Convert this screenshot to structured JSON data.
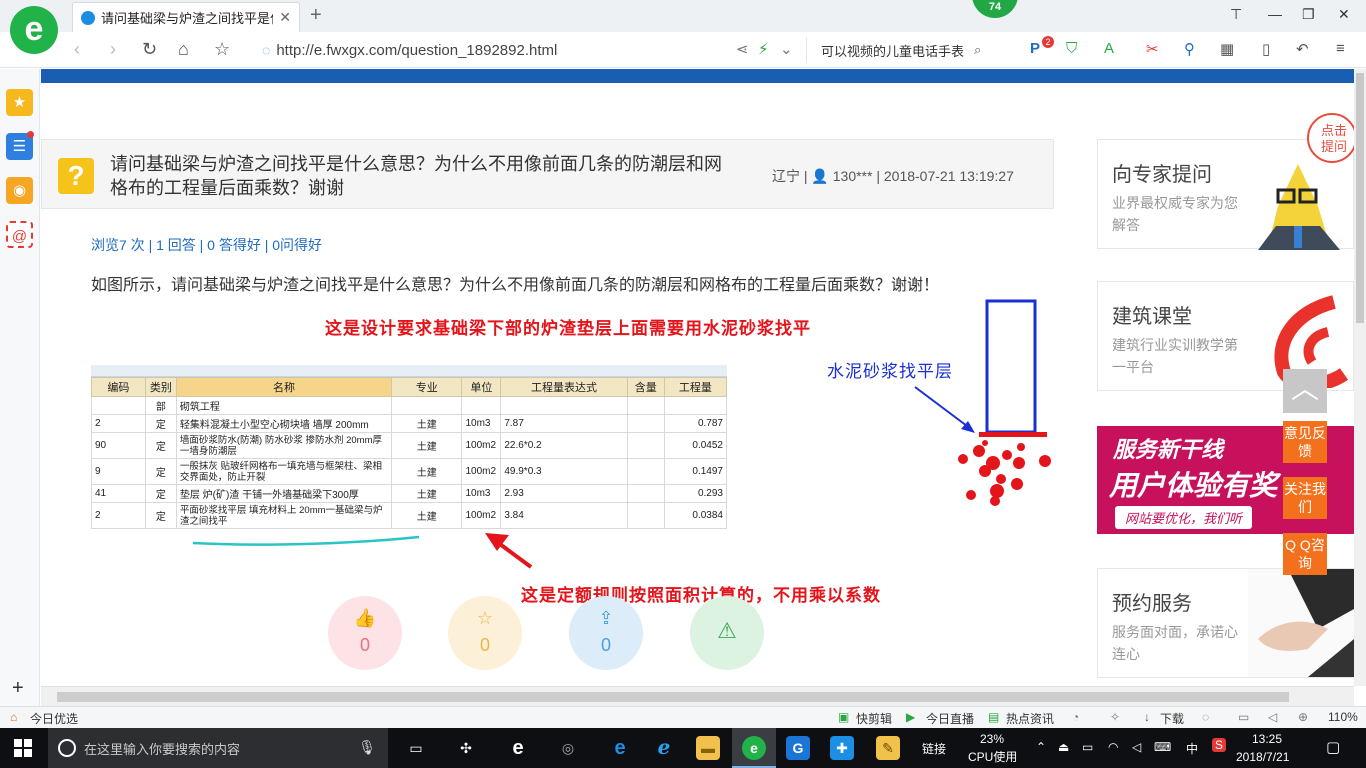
{
  "browser": {
    "tab_title": "请问基础梁与炉渣之间找平是什么",
    "new_tab_icon": "plus-icon",
    "badge_count": "74",
    "url": "http://e.fwxgx.com/question_1892892.html",
    "search_text": "可以视频的儿童电话手表",
    "toolbar_badge": "2"
  },
  "question": {
    "title": "请问基础梁与炉渣之间找平是什么意思？为什么不用像前面几条的防潮层和网格布的工程量后面乘数？谢谢",
    "location": "辽宁",
    "user": "130***",
    "time": "2018-07-21 13:19:27",
    "stats": "浏览7 次 | 1 回答 | 0 答得好 | 0问得好",
    "body": "如图所示，请问基础梁与炉渣之间找平是什么意思？为什么不用像前面几条的防潮层和网格布的工程量后面乘数？谢谢！",
    "annotation_top": "这是设计要求基础梁下部的炉渣垫层上面需要用水泥砂浆找平",
    "annotation_layer": "水泥砂浆找平层",
    "annotation_bottom": "这是定额规则按照面积计算的，不用乘以系数"
  },
  "table": {
    "headers": [
      "编码",
      "类别",
      "名称",
      "专业",
      "单位",
      "工程量表达式",
      "含量",
      "工程量"
    ],
    "rows": [
      [
        "",
        "部",
        "砌筑工程",
        "",
        "",
        "",
        "",
        ""
      ],
      [
        "2",
        "定",
        "轻集料混凝土小型空心砌块墙 墙厚 200mm",
        "土建",
        "10m3",
        "7.87",
        "",
        "0.787"
      ],
      [
        "90",
        "定",
        "墙面砂浆防水(防潮) 防水砂浆 掺防水剂 20mm厚一墙身防潮层",
        "土建",
        "100m2",
        "22.6*0.2",
        "",
        "0.0452"
      ],
      [
        "9",
        "定",
        "一般抹灰 贴玻纤网格布一填充墙与框架柱、梁相交界面处，防止开裂",
        "土建",
        "100m2",
        "49.9*0.3",
        "",
        "0.1497"
      ],
      [
        "41",
        "定",
        "垫层 炉(矿)渣 干铺一外墙基础梁下300厚",
        "土建",
        "10m3",
        "2.93",
        "",
        "0.293"
      ],
      [
        "2",
        "定",
        "平面砂浆找平层 填充材料上 20mm一基础梁与炉渣之间找平",
        "土建",
        "100m2",
        "3.84",
        "",
        "0.0384"
      ]
    ]
  },
  "reactions": [
    {
      "icon": "thumbs-up-icon",
      "count": "0"
    },
    {
      "icon": "star-icon",
      "count": "0"
    },
    {
      "icon": "share-icon",
      "count": "0"
    },
    {
      "icon": "warning-icon",
      "count": ""
    }
  ],
  "sidebar": {
    "expert": {
      "title": "向专家提问",
      "subtitle": "业界最权威专家为您解答",
      "bubble": "点击提问"
    },
    "academy": {
      "title": "建筑课堂",
      "subtitle": "建筑行业实训教学第一平台"
    },
    "banner": {
      "line1": "服务新干线",
      "line2": "用户体验有奖",
      "line3": "网站要优化，我们听"
    },
    "booking": {
      "title": "预约服务",
      "subtitle": "服务面对面，承诺心连心"
    }
  },
  "floating": {
    "feedback": "意见反馈",
    "follow": "关注我们",
    "qq": "Q Q咨询"
  },
  "statusbar": {
    "left": "今日优选",
    "kuaijianji": "快剪辑",
    "live": "今日直播",
    "news": "热点资讯",
    "download": "下载",
    "zoom": "110%"
  },
  "taskbar": {
    "search_placeholder": "在这里输入你要搜索的内容",
    "links": "链接",
    "cpu_percent": "23%",
    "cpu_label": "CPU使用",
    "ime": "中",
    "time": "13:25",
    "date": "2018/7/21"
  },
  "colors": {
    "brand_green": "#21b24a",
    "site_blue": "#1a5eb3",
    "annotation_red": "#e3151b",
    "annotation_blue": "#1a2fd6",
    "float_orange": "#f3711d"
  }
}
